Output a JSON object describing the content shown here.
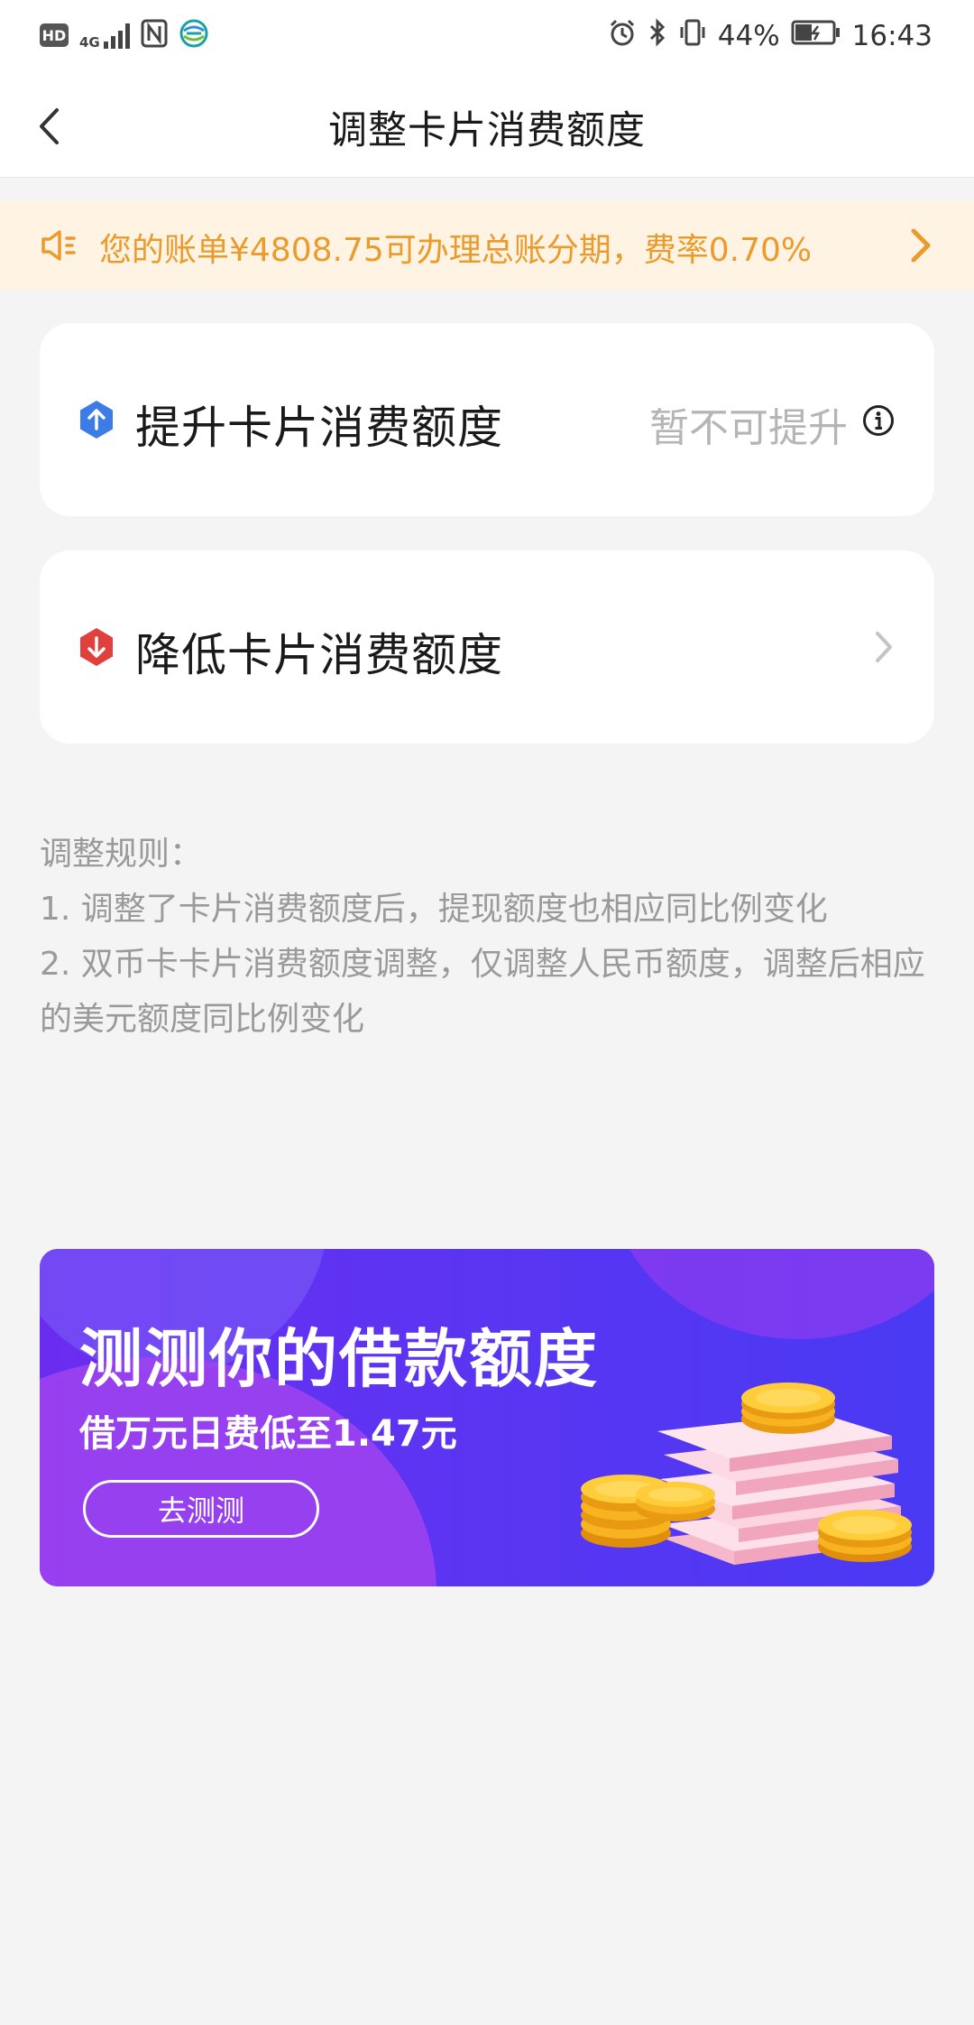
{
  "status_bar": {
    "hd": "HD",
    "network": "4G",
    "battery": "44%",
    "time": "16:43"
  },
  "nav": {
    "title": "调整卡片消费额度"
  },
  "notice": {
    "text": "您的账单¥4808.75可办理总账分期，费率0.70%",
    "color": "#eb9a2c"
  },
  "cards": {
    "increase": {
      "label": "提升卡片消费额度",
      "status": "暂不可提升",
      "icon_color": "#3d7be6"
    },
    "decrease": {
      "label": "降低卡片消费额度",
      "icon_color": "#e0413c"
    }
  },
  "rules": {
    "title": "调整规则：",
    "items": [
      "1. 调整了卡片消费额度后，提现额度也相应同比例变化",
      "2. 双币卡卡片消费额度调整，仅调整人民币额度，调整后相应的美元额度同比例变化"
    ]
  },
  "banner": {
    "title": "测测你的借款额度",
    "subtitle": "借万元日费低至1.47元",
    "button": "去测测"
  }
}
